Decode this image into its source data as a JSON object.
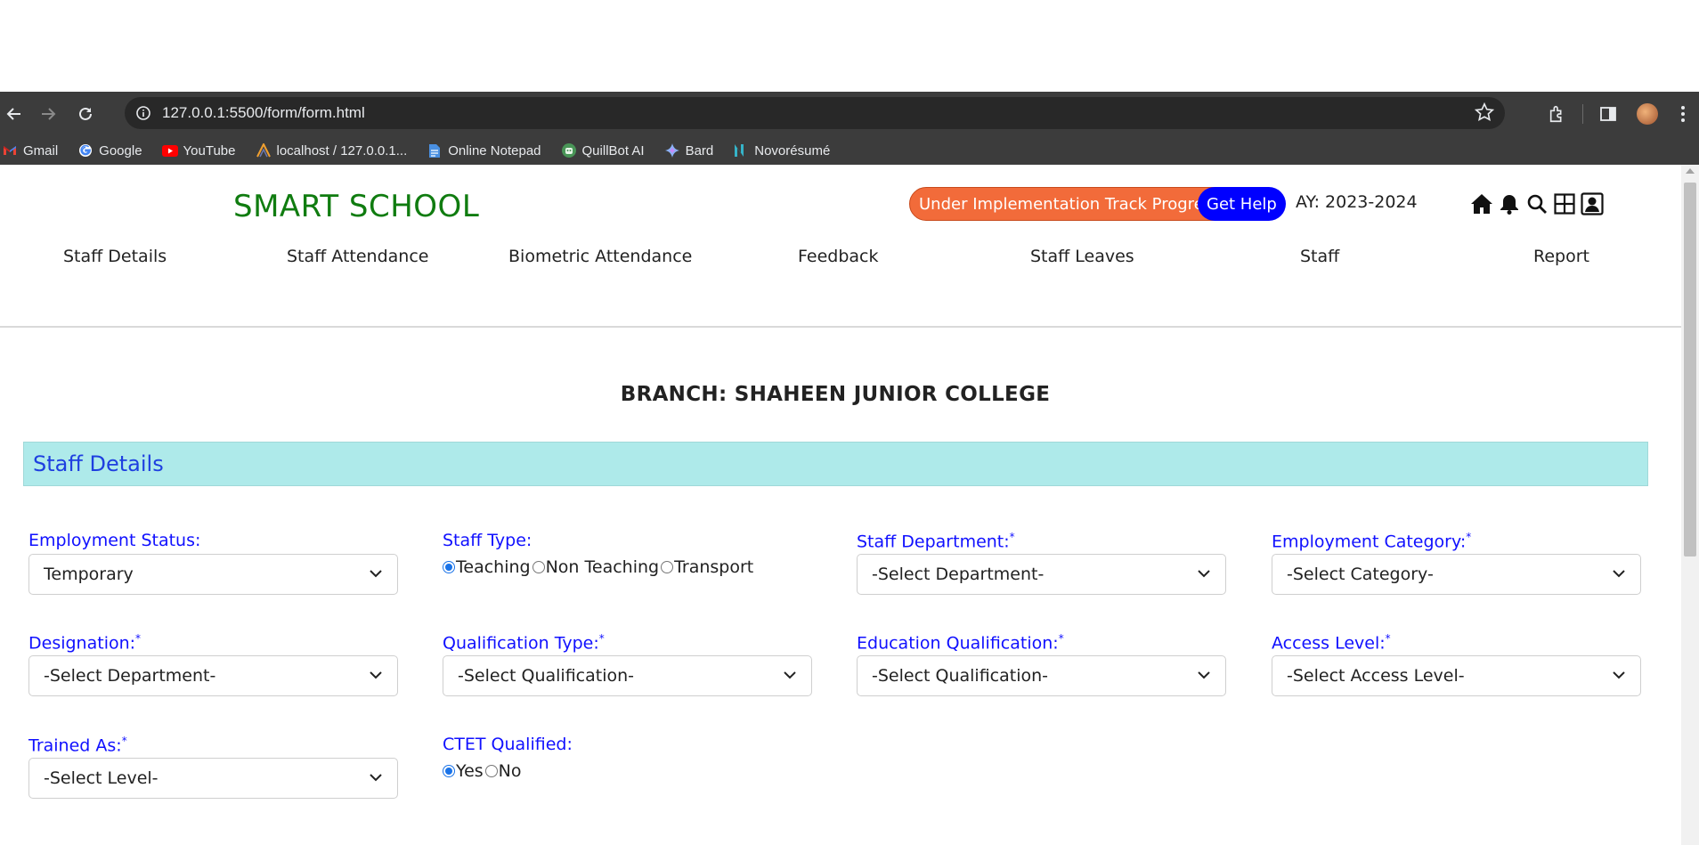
{
  "browser": {
    "url": "127.0.0.1:5500/form/form.html",
    "bookmarks": [
      {
        "label": "Gmail",
        "icon": "gmail-icon"
      },
      {
        "label": "Google",
        "icon": "google-icon"
      },
      {
        "label": "YouTube",
        "icon": "youtube-icon"
      },
      {
        "label": "localhost / 127.0.0.1...",
        "icon": "phpmyadmin-icon"
      },
      {
        "label": "Online Notepad",
        "icon": "notepad-icon"
      },
      {
        "label": "QuillBot AI",
        "icon": "quillbot-icon"
      },
      {
        "label": "Bard",
        "icon": "bard-icon"
      },
      {
        "label": "Novorésumé",
        "icon": "novoresume-icon"
      }
    ]
  },
  "header": {
    "brand": "SMART SCHOOL",
    "progress_button": "Under Implementation Track Progress",
    "help_button": "Get Help",
    "academic_year": "AY: 2023-2024",
    "icons": [
      "home-icon",
      "bell-icon",
      "search-icon",
      "grid-icon",
      "user-icon"
    ]
  },
  "nav": [
    "Staff Details",
    "Staff Attendance",
    "Biometric Attendance",
    "Feedback",
    "Staff Leaves",
    "Staff",
    "Report"
  ],
  "branch_title": "BRANCH: SHAHEEN JUNIOR COLLEGE",
  "section_title": "Staff Details",
  "form": {
    "employment_status": {
      "label": "Employment Status:",
      "value": "Temporary"
    },
    "staff_type": {
      "label": "Staff Type:",
      "options": [
        "Teaching",
        "Non Teaching",
        "Transport"
      ],
      "selected": "Teaching"
    },
    "staff_department": {
      "label": "Staff Department:",
      "required": "*",
      "value": "-Select Department-"
    },
    "employment_category": {
      "label": "Employment Category:",
      "required": "*",
      "value": "-Select Category-"
    },
    "designation": {
      "label": "Designation:",
      "required": "*",
      "value": "-Select Department-"
    },
    "qualification_type": {
      "label": "Qualification Type:",
      "required": "*",
      "value": "-Select Qualification-"
    },
    "education_qualification": {
      "label": "Education Qualification:",
      "required": "*",
      "value": "-Select Qualification-"
    },
    "access_level": {
      "label": "Access Level:",
      "required": "*",
      "value": "-Select Access Level-"
    },
    "trained_as": {
      "label": "Trained As:",
      "required": "*",
      "value": "-Select Level-"
    },
    "ctet_qualified": {
      "label": "CTET Qualified:",
      "options": [
        "Yes",
        "No"
      ],
      "selected": "Yes"
    }
  },
  "colors": {
    "brand": "#107c10",
    "progress": "#f26b3a",
    "help": "#0000ff",
    "section_bg": "#aeeaea",
    "label": "#1010ff"
  }
}
